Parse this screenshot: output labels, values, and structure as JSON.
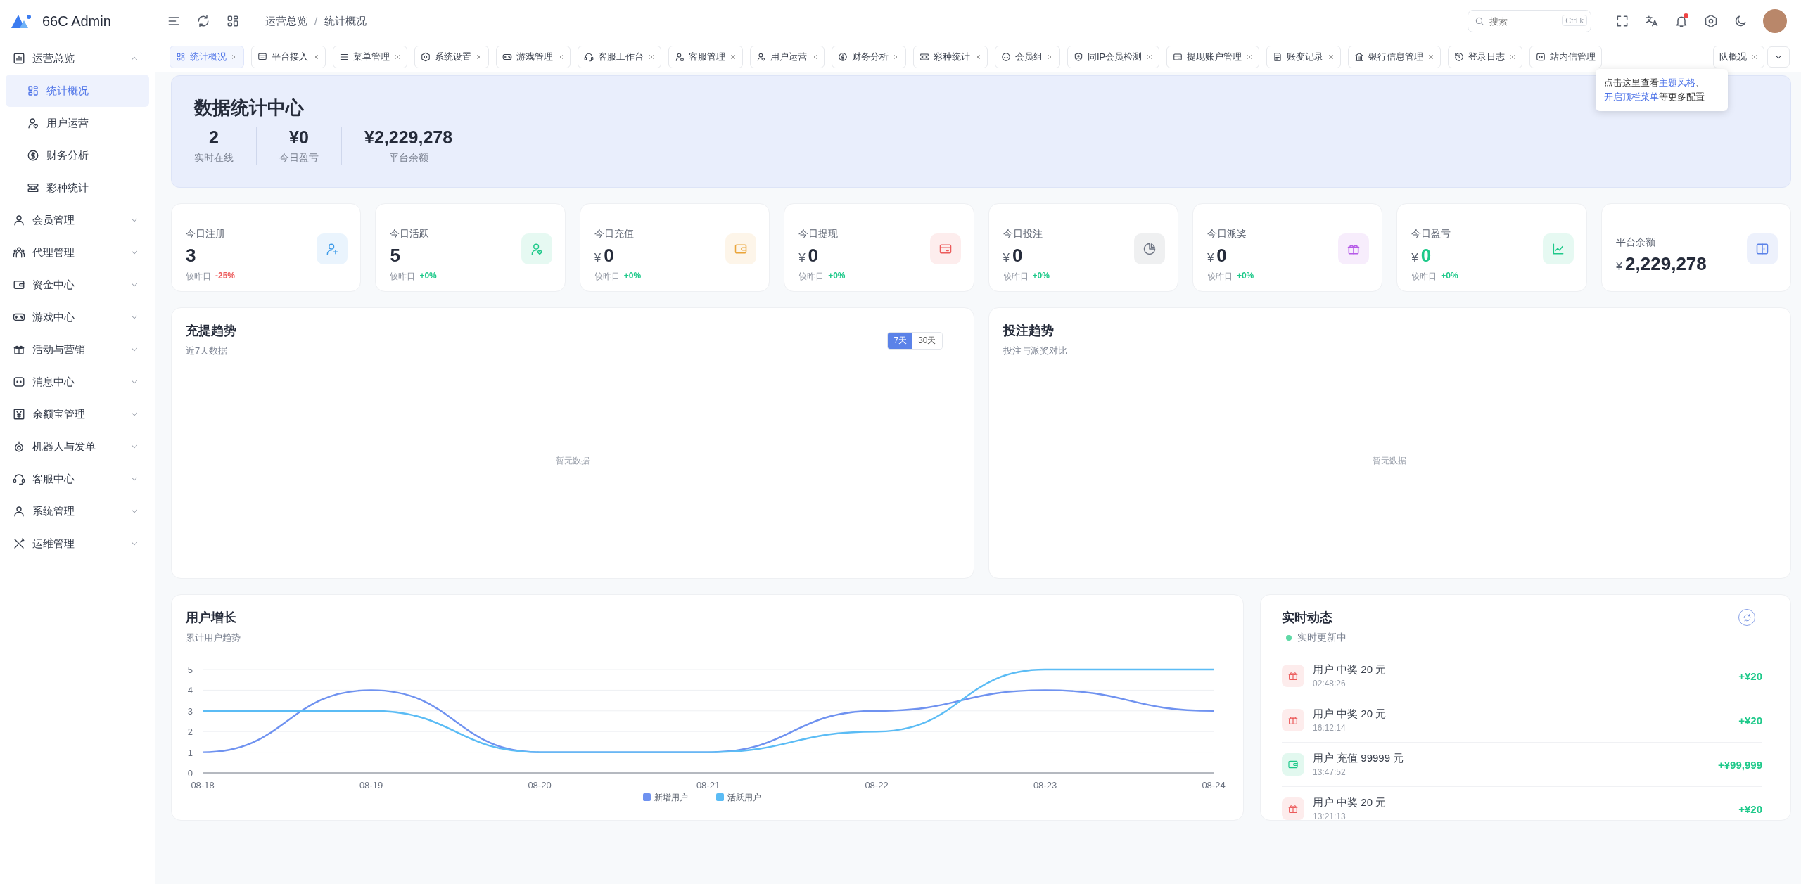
{
  "brand": {
    "name": "66C Admin"
  },
  "sidebar": {
    "items": [
      {
        "label": "运营总览",
        "selected": false,
        "expanded": true,
        "children": [
          {
            "label": "统计概况",
            "selected": true
          },
          {
            "label": "用户运营",
            "selected": false
          },
          {
            "label": "财务分析",
            "selected": false
          },
          {
            "label": "彩种统计",
            "selected": false
          }
        ]
      },
      {
        "label": "会员管理",
        "selected": false,
        "expanded": false
      },
      {
        "label": "代理管理",
        "selected": false,
        "expanded": false
      },
      {
        "label": "资金中心",
        "selected": false,
        "expanded": false
      },
      {
        "label": "游戏中心",
        "selected": false,
        "expanded": false
      },
      {
        "label": "活动与营销",
        "selected": false,
        "expanded": false
      },
      {
        "label": "消息中心",
        "selected": false,
        "expanded": false
      },
      {
        "label": "余额宝管理",
        "selected": false,
        "expanded": false
      },
      {
        "label": "机器人与发单",
        "selected": false,
        "expanded": false
      },
      {
        "label": "客服中心",
        "selected": false,
        "expanded": false
      },
      {
        "label": "系统管理",
        "selected": false,
        "expanded": false
      },
      {
        "label": "运维管理",
        "selected": false,
        "expanded": false
      }
    ]
  },
  "header": {
    "breadcrumb": {
      "items": [
        "运营总览",
        "统计概况"
      ],
      "separator": "/"
    },
    "search": {
      "placeholder": "搜索",
      "shortcut": "Ctrl k"
    },
    "unread": true
  },
  "tabs": [
    {
      "kind": "tab",
      "label": "统计概况",
      "selected": true,
      "closable": true
    },
    {
      "kind": "tab",
      "label": "平台接入",
      "selected": false,
      "closable": true
    },
    {
      "kind": "tab",
      "label": "菜单管理",
      "selected": false,
      "closable": true
    },
    {
      "kind": "tab",
      "label": "系统设置",
      "selected": false,
      "closable": true
    },
    {
      "kind": "tab",
      "label": "游戏管理",
      "selected": false,
      "closable": true
    },
    {
      "kind": "tab",
      "label": "客服工作台",
      "selected": false,
      "closable": true
    },
    {
      "kind": "tab",
      "label": "客服管理",
      "selected": false,
      "closable": true
    },
    {
      "kind": "tab",
      "label": "用户运营",
      "selected": false,
      "closable": true
    },
    {
      "kind": "tab",
      "label": "财务分析",
      "selected": false,
      "closable": true
    },
    {
      "kind": "tab",
      "label": "彩种统计",
      "selected": false,
      "closable": true
    },
    {
      "kind": "tab",
      "label": "会员组",
      "selected": false,
      "closable": true
    },
    {
      "kind": "tab",
      "label": "同IP会员检测",
      "selected": false,
      "closable": true
    },
    {
      "kind": "tab",
      "label": "提现账户管理",
      "selected": false,
      "closable": true
    },
    {
      "kind": "tab",
      "label": "账变记录",
      "selected": false,
      "closable": true
    },
    {
      "kind": "tab",
      "label": "银行信息管理",
      "selected": false,
      "closable": true
    },
    {
      "kind": "tab",
      "label": "登录日志",
      "selected": false,
      "closable": true
    },
    {
      "kind": "tab",
      "label": "站内信管理",
      "selected": false,
      "closable": false
    },
    {
      "kind": "clipped",
      "label": "队概况",
      "selected": false,
      "closable": true
    }
  ],
  "tooltip": {
    "lines": [
      [
        {
          "text": "点击这里查看",
          "link": false
        },
        {
          "text": "主题风格",
          "link": true
        },
        {
          "text": "、",
          "link": false
        }
      ],
      [
        {
          "text": "开启顶栏菜单",
          "link": true
        },
        {
          "text": "等更多配置",
          "link": false
        }
      ]
    ]
  },
  "overview": {
    "title": "数据统计中心",
    "stats": [
      {
        "value": "2",
        "label": "实时在线"
      },
      {
        "value": "¥0",
        "label": "今日盈亏"
      },
      {
        "value": "¥2,229,278",
        "label": "平台余额"
      }
    ]
  },
  "cards": [
    {
      "label": "今日注册",
      "value": "3",
      "compare": "较昨日",
      "change": {
        "text": "-25%",
        "color": "#ec5b5b"
      },
      "color": "#3d9be9",
      "highlight": false
    },
    {
      "label": "今日活跃",
      "value": "5",
      "compare": "较昨日",
      "change": {
        "text": "+0%",
        "color": "#1ec98a"
      },
      "color": "#1ec98a",
      "highlight": false
    },
    {
      "label": "今日充值",
      "currency": "¥",
      "value": "0",
      "compare": "较昨日",
      "change": {
        "text": "+0%",
        "color": "#1ec98a"
      },
      "color": "#eaa53a",
      "highlight": false
    },
    {
      "label": "今日提现",
      "currency": "¥",
      "value": "0",
      "compare": "较昨日",
      "change": {
        "text": "+0%",
        "color": "#1ec98a"
      },
      "color": "#ec5b5b",
      "highlight": false
    },
    {
      "label": "今日投注",
      "currency": "¥",
      "value": "0",
      "compare": "较昨日",
      "change": {
        "text": "+0%",
        "color": "#1ec98a"
      },
      "color": "#6b7280",
      "highlight": false
    },
    {
      "label": "今日派奖",
      "currency": "¥",
      "value": "0",
      "compare": "较昨日",
      "change": {
        "text": "+0%",
        "color": "#1ec98a"
      },
      "color": "#b65be8",
      "highlight": false
    },
    {
      "label": "今日盈亏",
      "currency": "¥",
      "value": "0",
      "compare": "较昨日",
      "change": {
        "text": "+0%",
        "color": "#1ec98a"
      },
      "color": "#1ec98a",
      "highlight": true
    },
    {
      "label": "平台余额",
      "currency": "¥",
      "value": "2,229,278",
      "color": "#5b82e8",
      "highlight": false
    }
  ],
  "trend_panels": [
    {
      "title": "充提趋势",
      "subtitle": "近7天数据",
      "ranges": [
        {
          "label": "7天",
          "selected": true
        },
        {
          "label": "30天",
          "selected": false
        }
      ],
      "empty": "暂无数据"
    },
    {
      "title": "投注趋势",
      "subtitle": "投注与派奖对比",
      "empty": "暂无数据"
    }
  ],
  "growth": {
    "title": "用户增长",
    "subtitle": "累计用户趋势",
    "chart_data": {
      "type": "line",
      "categories": [
        "08-18",
        "08-19",
        "08-20",
        "08-21",
        "08-22",
        "08-23",
        "08-24"
      ],
      "ylim": [
        0,
        5
      ],
      "yticks": [
        {
          "value": 0,
          "label": "0"
        },
        {
          "value": 1,
          "label": "1"
        },
        {
          "value": 2,
          "label": "2"
        },
        {
          "value": 3,
          "label": "3"
        },
        {
          "value": 4,
          "label": "4"
        },
        {
          "value": 5,
          "label": "5"
        }
      ],
      "grid": true,
      "legend": true,
      "series": [
        {
          "name": "新增用户",
          "color": "#6f92f0",
          "values": [
            1,
            4,
            1,
            1,
            3,
            4,
            3
          ]
        },
        {
          "name": "活跃用户",
          "color": "#5bbcf5",
          "values": [
            3,
            3,
            1,
            1,
            2,
            5,
            5
          ]
        }
      ]
    }
  },
  "activity": {
    "title": "实时动态",
    "status": "实时更新中",
    "items": [
      {
        "kind": "prize",
        "text": "用户 中奖 20 元",
        "time": "02:48:26",
        "amount": "+¥20"
      },
      {
        "kind": "prize",
        "text": "用户 中奖 20 元",
        "time": "16:12:14",
        "amount": "+¥20"
      },
      {
        "kind": "recharge",
        "text": "用户 充值 99999 元",
        "time": "13:47:52",
        "amount": "+¥99,999"
      },
      {
        "kind": "prize",
        "text": "用户 中奖 20 元",
        "time": "13:21:13",
        "amount": "+¥20"
      }
    ]
  }
}
